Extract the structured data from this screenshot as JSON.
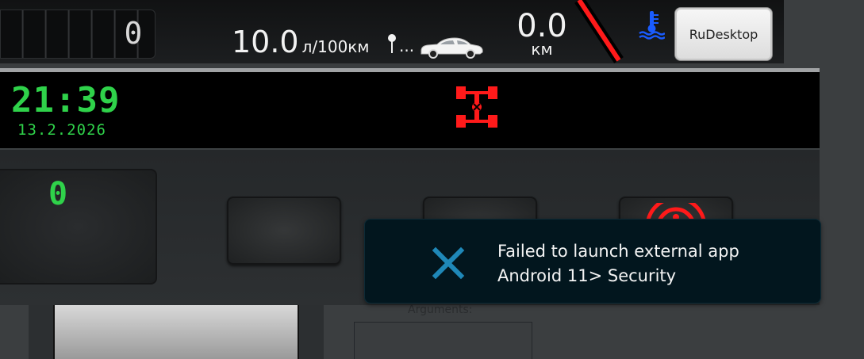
{
  "dashboard": {
    "odometer_digit": "0",
    "consumption_value": "10.0",
    "consumption_unit": "л/100км",
    "consumption_dots": "...",
    "distance_value": "0.0",
    "distance_unit": "км"
  },
  "clock": {
    "time": "21:39",
    "date": "13.2.2026"
  },
  "gear": {
    "digit": "0"
  },
  "rudesktop": {
    "button_label": "RuDesktop"
  },
  "form": {
    "arguments_label": "Arguments:"
  },
  "toast": {
    "line1": "Failed to launch external app",
    "line2": "Android 11> Security",
    "icon": "close-icon"
  },
  "colors": {
    "clock_green": "#2fd24a",
    "warning_red": "#ff1a1a",
    "toast_bg": "#02161e",
    "toast_icon": "#1f88b8",
    "temp_blue": "#1a5cff"
  }
}
